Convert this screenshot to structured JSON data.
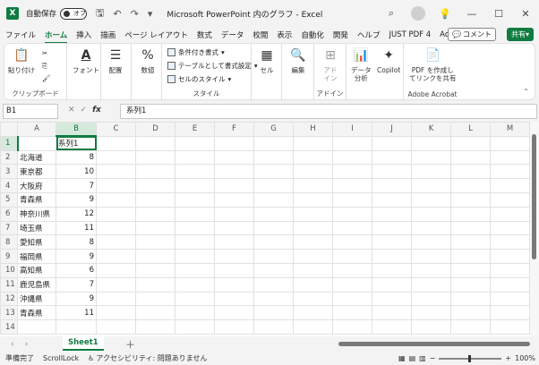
{
  "titlebar": {
    "app_icon": "excel-icon",
    "autosave_label": "自動保存",
    "autosave_state": "オフ",
    "title": "Microsoft PowerPoint 内のグラフ  -  Excel"
  },
  "tabs": [
    "ファイル",
    "ホーム",
    "挿入",
    "描画",
    "ページ レイアウト",
    "数式",
    "データ",
    "校閲",
    "表示",
    "自動化",
    "開発",
    "ヘルプ",
    "JUST PDF 4",
    "Acrobat"
  ],
  "active_tab": "ホーム",
  "comment_label": "コメント",
  "share_label": "共有",
  "ribbon": {
    "clipboard": {
      "paste": "貼り付け",
      "group": "クリップボード"
    },
    "font": {
      "label": "フォント"
    },
    "align": {
      "label": "配置"
    },
    "number": {
      "label": "数値"
    },
    "styles": {
      "cond": "条件付き書式",
      "table": "テーブルとして書式設定",
      "cell": "セルのスタイル",
      "group": "スタイル"
    },
    "cells": {
      "label": "セル"
    },
    "editing": {
      "label": "編集"
    },
    "addins": {
      "label": "アド\nイン",
      "group": "アドイン"
    },
    "analyze": {
      "label": "データ\n分析"
    },
    "copilot": {
      "label": "Copilot"
    },
    "acrobat": {
      "label": "PDF を作成し\nてリンクを共有",
      "group": "Adobe Acrobat"
    }
  },
  "formula": {
    "namebox": "B1",
    "content": "系列1"
  },
  "columns": [
    "A",
    "B",
    "C",
    "D",
    "E",
    "F",
    "G",
    "H",
    "I",
    "J",
    "K",
    "L",
    "M"
  ],
  "rows": [
    {
      "n": "1",
      "a": "",
      "b": "系列1"
    },
    {
      "n": "2",
      "a": "北海道",
      "b": "8"
    },
    {
      "n": "3",
      "a": "東京都",
      "b": "10"
    },
    {
      "n": "4",
      "a": "大阪府",
      "b": "7"
    },
    {
      "n": "5",
      "a": "青森県",
      "b": "9"
    },
    {
      "n": "6",
      "a": "神奈川県",
      "b": "12"
    },
    {
      "n": "7",
      "a": "埼玉県",
      "b": "11"
    },
    {
      "n": "8",
      "a": "愛知県",
      "b": "8"
    },
    {
      "n": "9",
      "a": "福岡県",
      "b": "9"
    },
    {
      "n": "10",
      "a": "高知県",
      "b": "6"
    },
    {
      "n": "11",
      "a": "鹿児島県",
      "b": "7"
    },
    {
      "n": "12",
      "a": "沖縄県",
      "b": "9"
    },
    {
      "n": "13",
      "a": "青森県",
      "b": "11"
    },
    {
      "n": "14",
      "a": "",
      "b": ""
    }
  ],
  "sheet_tab": "Sheet1",
  "status": {
    "ready": "準備完了",
    "scrolllock": "ScrollLock",
    "accessibility": "アクセシビリティ: 問題ありません",
    "zoom": "100%"
  }
}
